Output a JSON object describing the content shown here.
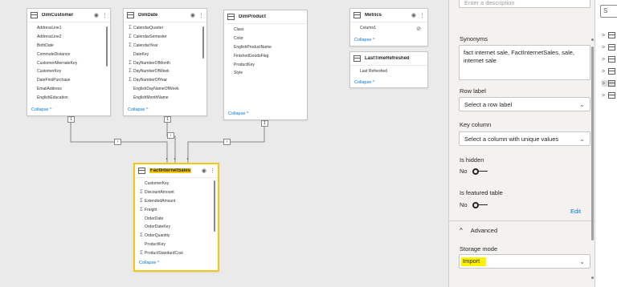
{
  "colors": {
    "accent": "#f2c811",
    "link": "#0078d4",
    "highlight": "#fff200"
  },
  "tables": {
    "dim_customer": {
      "name": "DimCustomer",
      "fields": [
        {
          "name": "AddressLine1",
          "sigma": false
        },
        {
          "name": "AddressLine2",
          "sigma": false
        },
        {
          "name": "BirthDate",
          "sigma": false
        },
        {
          "name": "CommuteDistance",
          "sigma": false
        },
        {
          "name": "CustomerAlternateKey",
          "sigma": false
        },
        {
          "name": "CustomerKey",
          "sigma": false
        },
        {
          "name": "DateFirstPurchase",
          "sigma": false
        },
        {
          "name": "EmailAddress",
          "sigma": false
        },
        {
          "name": "EnglishEducation",
          "sigma": false
        }
      ],
      "collapse": "Collapse ^"
    },
    "dim_date": {
      "name": "DimDate",
      "fields": [
        {
          "name": "CalendarQuarter",
          "sigma": true
        },
        {
          "name": "CalendarSemester",
          "sigma": true
        },
        {
          "name": "CalendarYear",
          "sigma": true
        },
        {
          "name": "DateKey",
          "sigma": false
        },
        {
          "name": "DayNumberOfMonth",
          "sigma": true
        },
        {
          "name": "DayNumberOfWeek",
          "sigma": true
        },
        {
          "name": "DayNumberOfYear",
          "sigma": true
        },
        {
          "name": "EnglishDayNameOfWeek",
          "sigma": false
        },
        {
          "name": "EnglishMonthName",
          "sigma": false
        }
      ],
      "collapse": "Collapse ^"
    },
    "dim_product": {
      "name": "DimProduct",
      "fields": [
        {
          "name": "Class",
          "sigma": false
        },
        {
          "name": "Color",
          "sigma": false
        },
        {
          "name": "EnglishProductName",
          "sigma": false
        },
        {
          "name": "FinishedGoodsFlag",
          "sigma": false
        },
        {
          "name": "ProductKey",
          "sigma": false
        },
        {
          "name": "Style",
          "sigma": false
        }
      ],
      "collapse": "Collapse ^"
    },
    "metrics": {
      "name": "Metrics",
      "fields": [
        {
          "name": "Column1",
          "sigma": false
        }
      ],
      "collapse": "Collapse ^"
    },
    "last_time_refreshed": {
      "name": "LastTimeRefreshed",
      "fields": [
        {
          "name": "Last Refreshed",
          "sigma": false
        }
      ],
      "collapse": "Collapse ^"
    },
    "fact_internet_sales": {
      "name": "FactInternetSales",
      "fields": [
        {
          "name": "CustomerKey",
          "sigma": false
        },
        {
          "name": "DiscountAmount",
          "sigma": true
        },
        {
          "name": "ExtendedAmount",
          "sigma": true
        },
        {
          "name": "Freight",
          "sigma": true
        },
        {
          "name": "OrderDate",
          "sigma": false
        },
        {
          "name": "OrderDateKey",
          "sigma": false
        },
        {
          "name": "OrderQuantity",
          "sigma": true
        },
        {
          "name": "ProductKey",
          "sigma": false
        },
        {
          "name": "ProductStandardCost",
          "sigma": true
        }
      ],
      "collapse": "Collapse ^"
    }
  },
  "relationships": {
    "one": "1",
    "many": "*"
  },
  "properties": {
    "description_placeholder": "Enter a description",
    "synonyms_label": "Synonyms",
    "synonyms_value": "fact internet sale, FactInternetSales, sale, internet sale",
    "row_label_label": "Row label",
    "row_label_value": "Select a row label",
    "key_column_label": "Key column",
    "key_column_value": "Select a column with unique values",
    "is_hidden_label": "Is hidden",
    "is_hidden_value": "No",
    "is_featured_label": "Is featured table",
    "is_featured_value": "No",
    "edit_link": "Edit",
    "advanced_label": "Advanced",
    "storage_mode_label": "Storage mode",
    "storage_mode_value": "Import"
  },
  "fields_pane": {
    "search_glyph": "S",
    "items": [
      ">",
      ">",
      ">",
      ">",
      ">",
      ">"
    ]
  }
}
